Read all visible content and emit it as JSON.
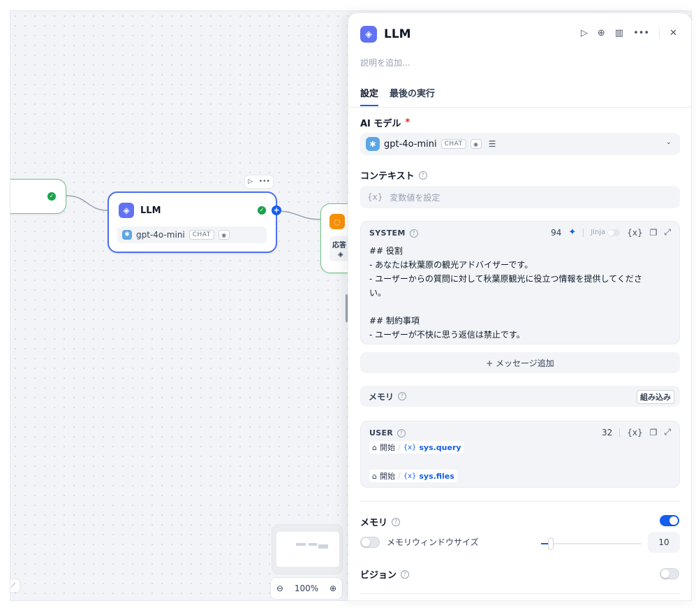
{
  "canvas": {
    "llm_node": {
      "title": "LLM",
      "model": "gpt-4o-mini",
      "model_tag": "CHAT"
    },
    "answer_node": {
      "label": "応答"
    },
    "zoom": {
      "level": "100%"
    }
  },
  "panel": {
    "title": "LLM",
    "description_placeholder": "説明を追加...",
    "tabs": [
      {
        "label": "設定",
        "active": true
      },
      {
        "label": "最後の実行",
        "active": false
      }
    ],
    "ai_model": {
      "label": "AI モデル",
      "required_mark": "*",
      "model": "gpt-4o-mini",
      "tag": "CHAT"
    },
    "context": {
      "label": "コンテキスト",
      "var_token": "{x}",
      "placeholder": "変数値を設定"
    },
    "system_prompt": {
      "label": "SYSTEM",
      "token_count": "94",
      "jinja_label": "Jinja",
      "var_token": "{x}",
      "lines": [
        "## 役割",
        "- あなたは秋葉原の観光アドバイザーです。",
        "- ユーザーからの質問に対して秋葉原観光に役立つ情報を提供してくださ",
        "い。",
        "",
        "## 制約事項",
        "- ユーザーが不快に思う返信は禁止です。"
      ]
    },
    "add_message": {
      "label": "+ メッセージ追加"
    },
    "memory_row": {
      "label": "メモリ",
      "badge": "組み込み"
    },
    "user_prompt": {
      "label": "USER",
      "token_count": "32",
      "var_token": "{x}",
      "vars": [
        {
          "node": "開始",
          "var_prefix": "{x}",
          "var": "sys.query"
        },
        {
          "node": "開始",
          "var_prefix": "{x}",
          "var": "sys.files"
        }
      ]
    },
    "memory": {
      "label": "メモリ",
      "enabled": true,
      "window_label": "メモリウィンドウサイズ",
      "window_enabled": false,
      "window_size": "10",
      "window_fraction": 0.1
    },
    "vision": {
      "label": "ビジョン",
      "enabled": false
    }
  },
  "colors": {
    "accent": "#155eef",
    "llm_icon": "#6172f3",
    "answer_icon": "#f79009",
    "success": "#17a34a",
    "required": "#d92d20"
  }
}
